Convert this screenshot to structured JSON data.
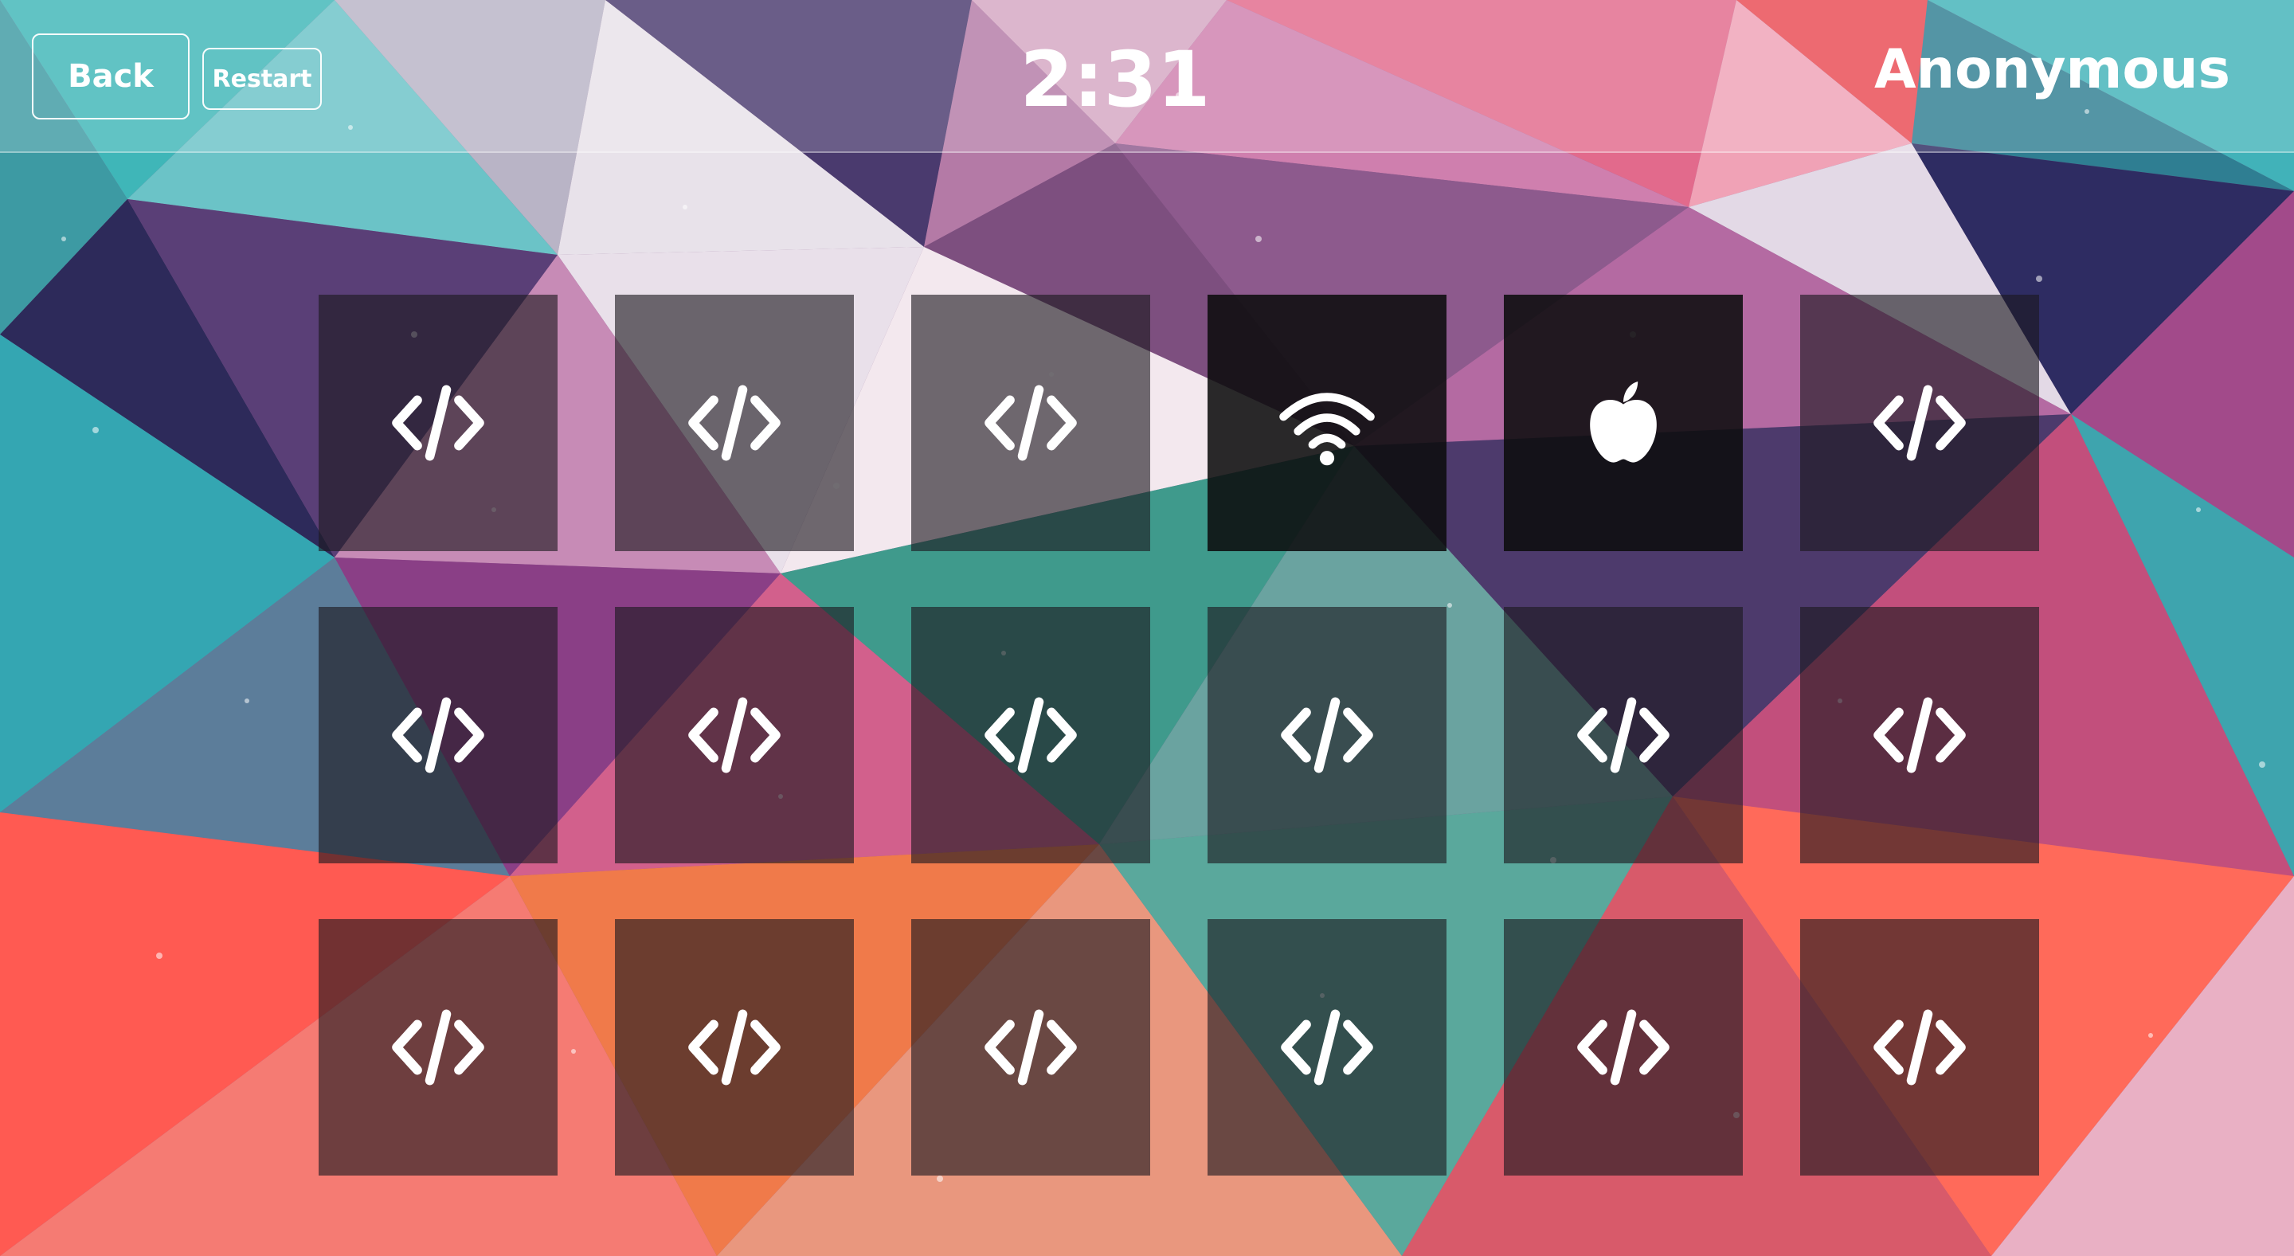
{
  "header": {
    "back_label": "Back",
    "restart_label": "Restart",
    "timer": "2:31",
    "player_name": "Anonymous"
  },
  "colors": {
    "card_hidden": "#1c181e",
    "card_revealed": "#0c0c0e",
    "icon": "#ffffff"
  },
  "cards": [
    {
      "state": "hidden",
      "icon": "code-icon"
    },
    {
      "state": "hidden",
      "icon": "code-icon"
    },
    {
      "state": "hidden",
      "icon": "code-icon"
    },
    {
      "state": "revealed",
      "icon": "wifi-icon"
    },
    {
      "state": "revealed",
      "icon": "apple-icon"
    },
    {
      "state": "hidden",
      "icon": "code-icon"
    },
    {
      "state": "hidden",
      "icon": "code-icon"
    },
    {
      "state": "hidden",
      "icon": "code-icon"
    },
    {
      "state": "hidden",
      "icon": "code-icon"
    },
    {
      "state": "hidden",
      "icon": "code-icon"
    },
    {
      "state": "hidden",
      "icon": "code-icon"
    },
    {
      "state": "hidden",
      "icon": "code-icon"
    },
    {
      "state": "hidden",
      "icon": "code-icon"
    },
    {
      "state": "hidden",
      "icon": "code-icon"
    },
    {
      "state": "hidden",
      "icon": "code-icon"
    },
    {
      "state": "hidden",
      "icon": "code-icon"
    },
    {
      "state": "hidden",
      "icon": "code-icon"
    },
    {
      "state": "hidden",
      "icon": "code-icon"
    }
  ]
}
